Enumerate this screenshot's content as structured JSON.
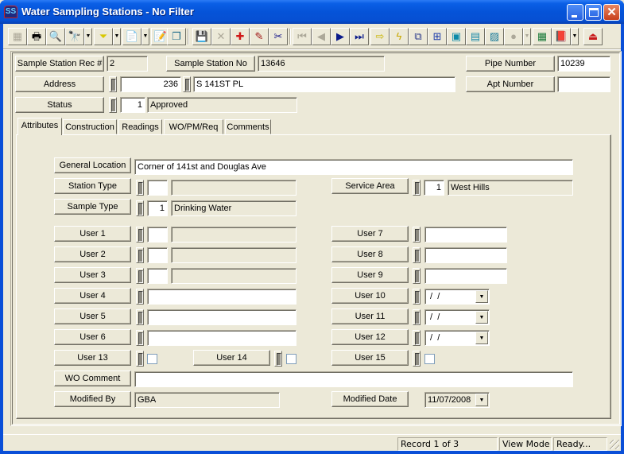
{
  "window": {
    "title": "Water Sampling Stations - No Filter",
    "app_icon_text": "SS",
    "controls": {
      "minimize": "minimize",
      "maximize": "maximize",
      "close": "✕"
    }
  },
  "toolbar": {
    "buttons": [
      {
        "icon": "form-view-icon",
        "glyph": "▦",
        "enabled": false
      },
      {
        "icon": "print-icon",
        "glyph": "🖶",
        "enabled": true
      },
      {
        "icon": "print-preview-icon",
        "glyph": "🔍",
        "enabled": true
      },
      {
        "icon": "find-icon",
        "glyph": "🔭",
        "enabled": true,
        "dropdown": true
      },
      {
        "icon": "filter-icon",
        "glyph": "⏷",
        "enabled": true,
        "dropdown": true
      },
      {
        "icon": "report-icon",
        "glyph": "📄",
        "enabled": true,
        "dropdown": true
      },
      {
        "icon": "properties-icon",
        "glyph": "📝",
        "enabled": false
      },
      {
        "icon": "copy-record-icon",
        "glyph": "❐",
        "enabled": true
      },
      {
        "icon": "save-icon",
        "glyph": "💾",
        "enabled": false
      },
      {
        "icon": "delete-icon",
        "glyph": "✕",
        "enabled": false
      },
      {
        "icon": "add-record-icon",
        "glyph": "✚",
        "enabled": true
      },
      {
        "icon": "edit-icon",
        "glyph": "✎",
        "enabled": true
      },
      {
        "icon": "cut-icon",
        "glyph": "✂",
        "enabled": true
      },
      {
        "icon": "first-record-icon",
        "glyph": "⏮",
        "enabled": false
      },
      {
        "icon": "previous-record-icon",
        "glyph": "◀",
        "enabled": false
      },
      {
        "icon": "next-record-icon",
        "glyph": "▶",
        "enabled": true
      },
      {
        "icon": "last-record-icon",
        "glyph": "⏭",
        "enabled": true
      },
      {
        "icon": "go-arrow-icon",
        "glyph": "⇨",
        "enabled": true
      },
      {
        "icon": "lightning-icon",
        "glyph": "ϟ",
        "enabled": true
      },
      {
        "icon": "hierarchy-icon",
        "glyph": "⧉",
        "enabled": true
      },
      {
        "icon": "relationship-icon",
        "glyph": "⊞",
        "enabled": true
      },
      {
        "icon": "work-order-icon",
        "glyph": "▣",
        "enabled": true
      },
      {
        "icon": "calculator-icon",
        "glyph": "▤",
        "enabled": true
      },
      {
        "icon": "map-icon",
        "glyph": "▨",
        "enabled": true
      },
      {
        "icon": "chat-icon",
        "glyph": "●",
        "enabled": false,
        "dropdown": true
      },
      {
        "icon": "spreadsheet-icon",
        "glyph": "▦",
        "enabled": true
      },
      {
        "icon": "book-icon",
        "glyph": "📕",
        "enabled": true,
        "dropdown": true
      },
      {
        "icon": "exit-icon",
        "glyph": "⏏",
        "enabled": true
      }
    ]
  },
  "header": {
    "rec_label": "Sample Station Rec #",
    "rec_value": "2",
    "station_no_label": "Sample Station No",
    "station_no_value": "13646",
    "pipe_number_label": "Pipe Number",
    "pipe_number_value": "10239",
    "address_label": "Address",
    "address_number": "236",
    "address_street": "S 141ST PL",
    "apt_number_label": "Apt Number",
    "apt_number_value": "",
    "status_label": "Status",
    "status_code": "1",
    "status_desc": "Approved"
  },
  "tabs": [
    {
      "label": "Attributes",
      "active": true
    },
    {
      "label": "Construction",
      "active": false
    },
    {
      "label": "Readings",
      "active": false
    },
    {
      "label": "WO/PM/Req",
      "active": false
    },
    {
      "label": "Comments",
      "active": false
    }
  ],
  "attributes": {
    "general_location_label": "General Location",
    "general_location_value": "Corner of 141st and Douglas Ave",
    "station_type_label": "Station Type",
    "station_type_code": "",
    "station_type_desc": "",
    "service_area_label": "Service Area",
    "service_area_code": "1",
    "service_area_desc": "West Hills",
    "sample_type_label": "Sample Type",
    "sample_type_code": "1",
    "sample_type_desc": "Drinking Water",
    "user1_label": "User 1",
    "user1_code": "",
    "user1_desc": "",
    "user2_label": "User 2",
    "user2_code": "",
    "user2_desc": "",
    "user3_label": "User 3",
    "user3_code": "",
    "user3_desc": "",
    "user4_label": "User 4",
    "user4_value": "",
    "user5_label": "User 5",
    "user5_value": "",
    "user6_label": "User 6",
    "user6_value": "",
    "user7_label": "User 7",
    "user7_value": "",
    "user8_label": "User 8",
    "user8_value": "",
    "user9_label": "User 9",
    "user9_value": "",
    "user10_label": "User 10",
    "user10_value": " /  /",
    "user11_label": "User 11",
    "user11_value": " /  /",
    "user12_label": "User 12",
    "user12_value": " /  /",
    "user13_label": "User 13",
    "user13_checked": false,
    "user14_label": "User 14",
    "user14_checked": false,
    "user15_label": "User 15",
    "user15_checked": false,
    "wo_comment_label": "WO Comment",
    "wo_comment_value": "",
    "modified_by_label": "Modified By",
    "modified_by_value": "GBA",
    "modified_date_label": "Modified Date",
    "modified_date_value": "11/07/2008"
  },
  "statusbar": {
    "record": "Record 1 of 3",
    "mode": "View Mode",
    "state": "Ready..."
  },
  "colors": {
    "title_bar": "#0553d8",
    "face": "#ece9d8",
    "shadow": "#716f64",
    "close_button": "#c8401c"
  }
}
